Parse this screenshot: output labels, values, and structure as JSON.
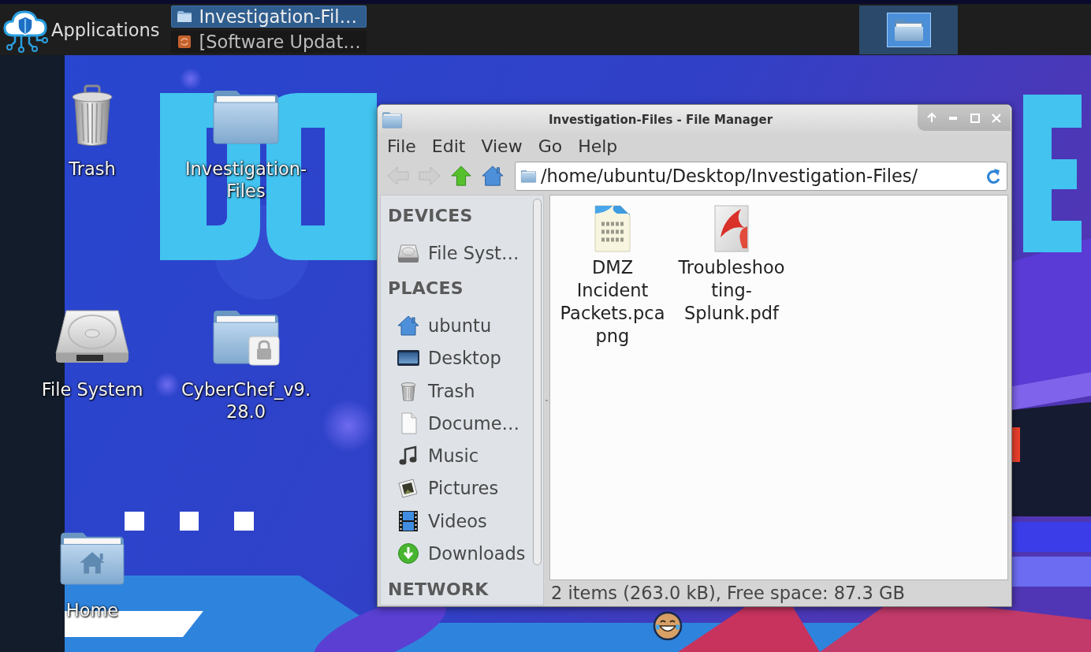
{
  "top_panel": {
    "applications": "Applications",
    "tasks": [
      {
        "title": "Investigation-Fil…",
        "kind": "folder",
        "selected": true
      },
      {
        "title": "[Software Updat…",
        "kind": "update",
        "selected": false
      }
    ],
    "workspaces": [
      {
        "selected": true
      }
    ]
  },
  "desktop_icons": [
    {
      "label": "Trash",
      "kind": "trash"
    },
    {
      "label": "Investigation-Files",
      "kind": "folder"
    },
    {
      "label": "File System",
      "kind": "drive"
    },
    {
      "label": "CyberChef_v9.28.0",
      "kind": "locked-folder"
    },
    {
      "label": "Home",
      "kind": "home-folder"
    }
  ],
  "window": {
    "title": "Investigation-Files - File Manager",
    "menu": [
      "File",
      "Edit",
      "View",
      "Go",
      "Help"
    ],
    "toolbar": [
      {
        "kind": "back",
        "disabled": true
      },
      {
        "kind": "forward",
        "disabled": true
      },
      {
        "kind": "up",
        "disabled": false
      },
      {
        "kind": "home",
        "disabled": false
      }
    ],
    "location": {
      "value": "/home/ubuntu/Desktop/Investigation-Files/"
    },
    "sidebar": [
      {
        "heading": "DEVICES",
        "items": [
          {
            "label": "File Syst…",
            "kind": "drive",
            "selected": false
          }
        ]
      },
      {
        "heading": "PLACES",
        "items": [
          {
            "label": "ubuntu",
            "kind": "home",
            "selected": false
          },
          {
            "label": "Desktop",
            "kind": "desktop",
            "selected": false
          },
          {
            "label": "Trash",
            "kind": "trash",
            "selected": false
          },
          {
            "label": "Docume…",
            "kind": "document",
            "selected": false
          },
          {
            "label": "Music",
            "kind": "music",
            "selected": false
          },
          {
            "label": "Pictures",
            "kind": "pictures",
            "selected": false
          },
          {
            "label": "Videos",
            "kind": "videos",
            "selected": false
          },
          {
            "label": "Downloads",
            "kind": "downloads",
            "selected": false
          }
        ]
      },
      {
        "heading": "NETWORK"
      }
    ],
    "files": [
      {
        "name": "DMZ Incident Packets.pcapng",
        "kind": "pcap",
        "selected": false
      },
      {
        "name": "Troubleshooting-Splunk.pdf",
        "kind": "pdf",
        "selected": false
      }
    ],
    "status_bar": "2 items (263.0 kB), Free space: 87.3 GB"
  }
}
